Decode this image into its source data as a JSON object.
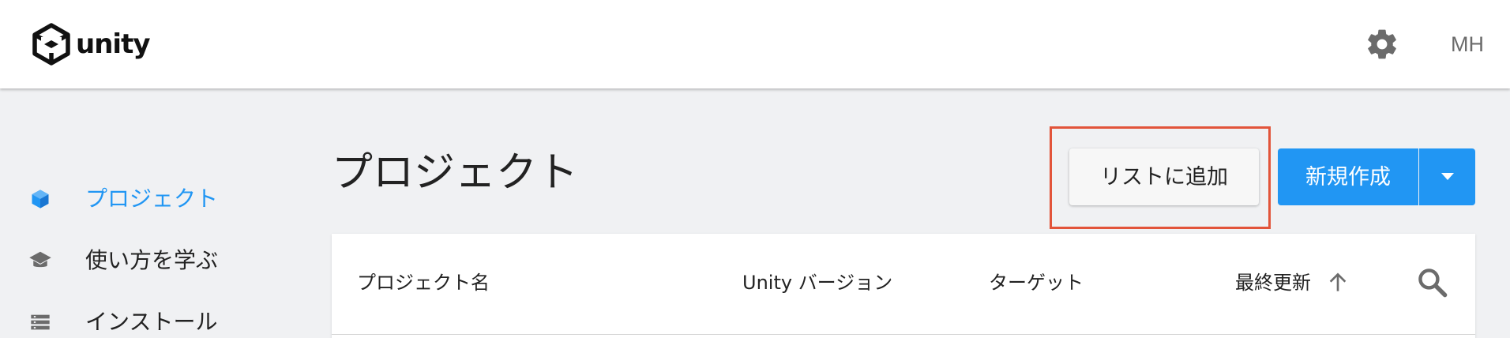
{
  "header": {
    "logo_text": "unity",
    "user_initials": "MH"
  },
  "sidebar": {
    "items": [
      {
        "label": "プロジェクト",
        "icon": "cube-icon",
        "active": true
      },
      {
        "label": "使い方を学ぶ",
        "icon": "graduation-cap-icon",
        "active": false
      },
      {
        "label": "インストール",
        "icon": "list-icon",
        "active": false
      }
    ]
  },
  "main": {
    "title": "プロジェクト",
    "add_to_list_label": "リストに追加",
    "new_label": "新規作成",
    "table": {
      "columns": [
        "プロジェクト名",
        "Unity バージョン",
        "ターゲット",
        "最終更新"
      ],
      "sort_direction": "ascending"
    }
  },
  "colors": {
    "accent": "#2196f3",
    "highlight": "#e2543a",
    "background": "#f0f1f3"
  }
}
